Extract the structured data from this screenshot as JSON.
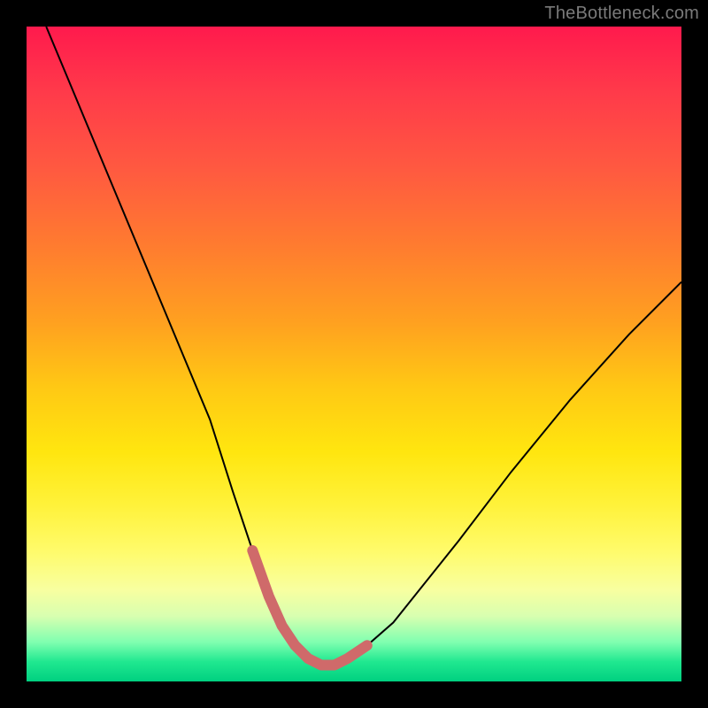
{
  "watermark": "TheBottleneck.com",
  "chart_data": {
    "type": "line",
    "title": "",
    "xlabel": "",
    "ylabel": "",
    "xlim": [
      0,
      1
    ],
    "ylim": [
      0,
      1
    ],
    "series": [
      {
        "name": "bottleneck-curve",
        "stroke": "#000000",
        "width": 2,
        "x": [
          0.03,
          0.08,
          0.13,
          0.18,
          0.23,
          0.28,
          0.315,
          0.345,
          0.37,
          0.39,
          0.41,
          0.43,
          0.45,
          0.47,
          0.49,
          0.52,
          0.56,
          0.6,
          0.66,
          0.74,
          0.83,
          0.92,
          1.0
        ],
        "values": [
          1.0,
          0.88,
          0.76,
          0.64,
          0.52,
          0.4,
          0.29,
          0.2,
          0.13,
          0.085,
          0.055,
          0.035,
          0.025,
          0.025,
          0.035,
          0.055,
          0.09,
          0.14,
          0.215,
          0.32,
          0.43,
          0.53,
          0.61
        ]
      },
      {
        "name": "tolerance-band",
        "stroke": "#cf6a6a",
        "width": 12,
        "linecap": "round",
        "x": [
          0.345,
          0.37,
          0.39,
          0.41,
          0.43,
          0.45,
          0.47,
          0.49,
          0.52
        ],
        "values": [
          0.2,
          0.13,
          0.085,
          0.055,
          0.035,
          0.025,
          0.025,
          0.035,
          0.055
        ]
      }
    ],
    "background_gradient": {
      "orientation": "vertical",
      "stops": [
        {
          "pos": 0.0,
          "color": "#ff1a4d"
        },
        {
          "pos": 0.5,
          "color": "#ffcc14"
        },
        {
          "pos": 0.8,
          "color": "#fffb6a"
        },
        {
          "pos": 1.0,
          "color": "#00d080"
        }
      ]
    }
  }
}
